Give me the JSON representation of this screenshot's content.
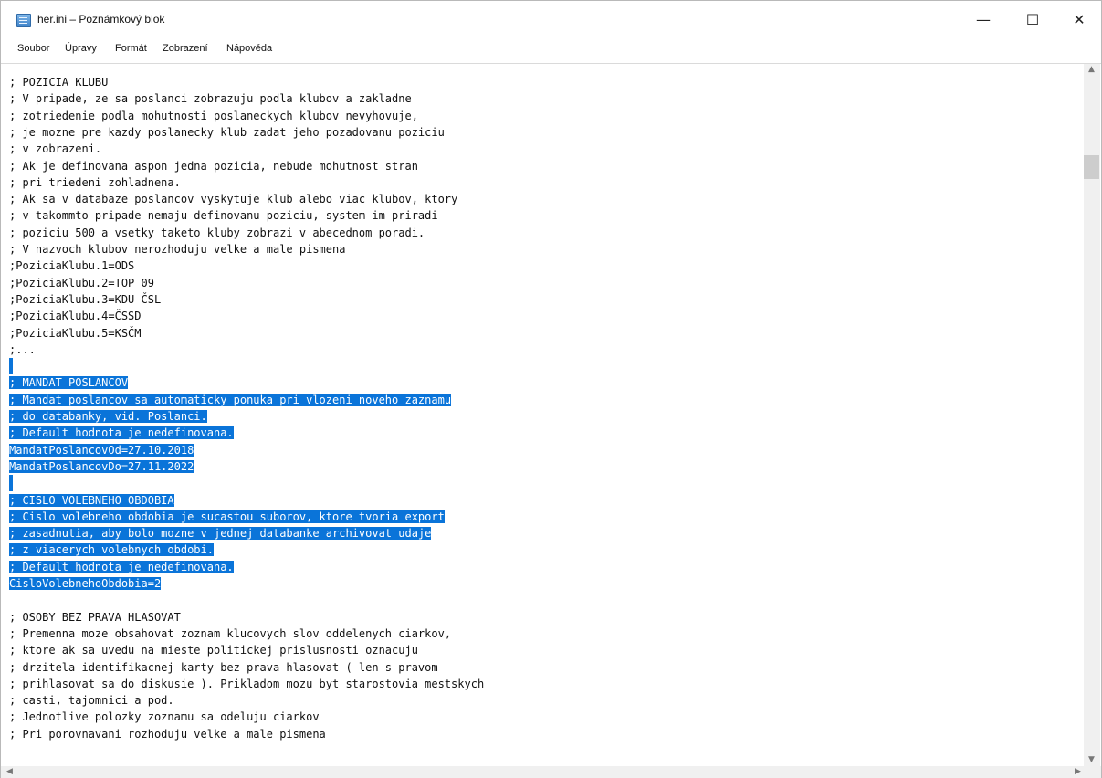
{
  "window": {
    "title": "her.ini – Poznámkový blok",
    "controls": {
      "minimize": "—",
      "maximize": "☐",
      "close": "✕"
    }
  },
  "menu": [
    {
      "label": "Soubor"
    },
    {
      "label": "Úpravy"
    },
    {
      "label": "Formát"
    },
    {
      "label": "Zobrazení"
    },
    {
      "label": "Nápověda"
    }
  ],
  "editor": {
    "lines": [
      {
        "text": "; POZICIA KLUBU",
        "selected": false
      },
      {
        "text": "; V pripade, ze sa poslanci zobrazuju podla klubov a zakladne",
        "selected": false
      },
      {
        "text": "; zotriedenie podla mohutnosti poslaneckych klubov nevyhovuje,",
        "selected": false
      },
      {
        "text": "; je mozne pre kazdy poslanecky klub zadat jeho pozadovanu poziciu",
        "selected": false
      },
      {
        "text": "; v zobrazeni.",
        "selected": false
      },
      {
        "text": "; Ak je definovana aspon jedna pozicia, nebude mohutnost stran",
        "selected": false
      },
      {
        "text": "; pri triedeni zohladnena.",
        "selected": false
      },
      {
        "text": "; Ak sa v databaze poslancov vyskytuje klub alebo viac klubov, ktory",
        "selected": false
      },
      {
        "text": "; v takommto pripade nemaju definovanu poziciu, system im priradi",
        "selected": false
      },
      {
        "text": "; poziciu 500 a vsetky taketo kluby zobrazi v abecednom poradi.",
        "selected": false
      },
      {
        "text": "; V nazvoch klubov nerozhoduju velke a male pismena",
        "selected": false
      },
      {
        "text": ";PoziciaKlubu.1=ODS",
        "selected": false
      },
      {
        "text": ";PoziciaKlubu.2=TOP 09",
        "selected": false
      },
      {
        "text": ";PoziciaKlubu.3=KDU-ČSL",
        "selected": false
      },
      {
        "text": ";PoziciaKlubu.4=ČSSD",
        "selected": false
      },
      {
        "text": ";PoziciaKlubu.5=KSČM",
        "selected": false
      },
      {
        "text": ";...",
        "selected": false
      },
      {
        "text": "",
        "selected": true
      },
      {
        "text": "; MANDAT POSLANCOV",
        "selected": true
      },
      {
        "text": "; Mandat poslancov sa automaticky ponuka pri vlozeni noveho zaznamu",
        "selected": true
      },
      {
        "text": "; do databanky, vid. Poslanci.",
        "selected": true
      },
      {
        "text": "; Default hodnota je nedefinovana.",
        "selected": true
      },
      {
        "text": "MandatPoslancovOd=27.10.2018",
        "selected": true
      },
      {
        "text": "MandatPoslancovDo=27.11.2022",
        "selected": true
      },
      {
        "text": "",
        "selected": true
      },
      {
        "text": "; CISLO VOLEBNEHO OBDOBIA",
        "selected": true
      },
      {
        "text": "; Cislo volebneho obdobia je sucastou suborov, ktore tvoria export",
        "selected": true
      },
      {
        "text": "; zasadnutia, aby bolo mozne v jednej databanke archivovat udaje",
        "selected": true
      },
      {
        "text": "; z viacerych volebnych obdobi.",
        "selected": true
      },
      {
        "text": "; Default hodnota je nedefinovana.",
        "selected": true
      },
      {
        "text": "CisloVolebnehoObdobia=2",
        "selected": true
      },
      {
        "text": "",
        "selected": false
      },
      {
        "text": "; OSOBY BEZ PRAVA HLASOVAT",
        "selected": false
      },
      {
        "text": "; Premenna moze obsahovat zoznam klucovych slov oddelenych ciarkov,",
        "selected": false
      },
      {
        "text": "; ktore ak sa uvedu na mieste politickej prislusnosti oznacuju",
        "selected": false
      },
      {
        "text": "; drzitela identifikacnej karty bez prava hlasovat ( len s pravom",
        "selected": false
      },
      {
        "text": "; prihlasovat sa do diskusie ). Prikladom mozu byt starostovia mestskych",
        "selected": false
      },
      {
        "text": "; casti, tajomnici a pod.",
        "selected": false
      },
      {
        "text": "; Jednotlive polozky zoznamu sa odeluju ciarkov",
        "selected": false
      },
      {
        "text": "; Pri porovnavani rozhoduju velke a male pismena",
        "selected": false
      }
    ]
  },
  "colors": {
    "selection": "#0a74d9",
    "selection_text": "#ffffff"
  }
}
